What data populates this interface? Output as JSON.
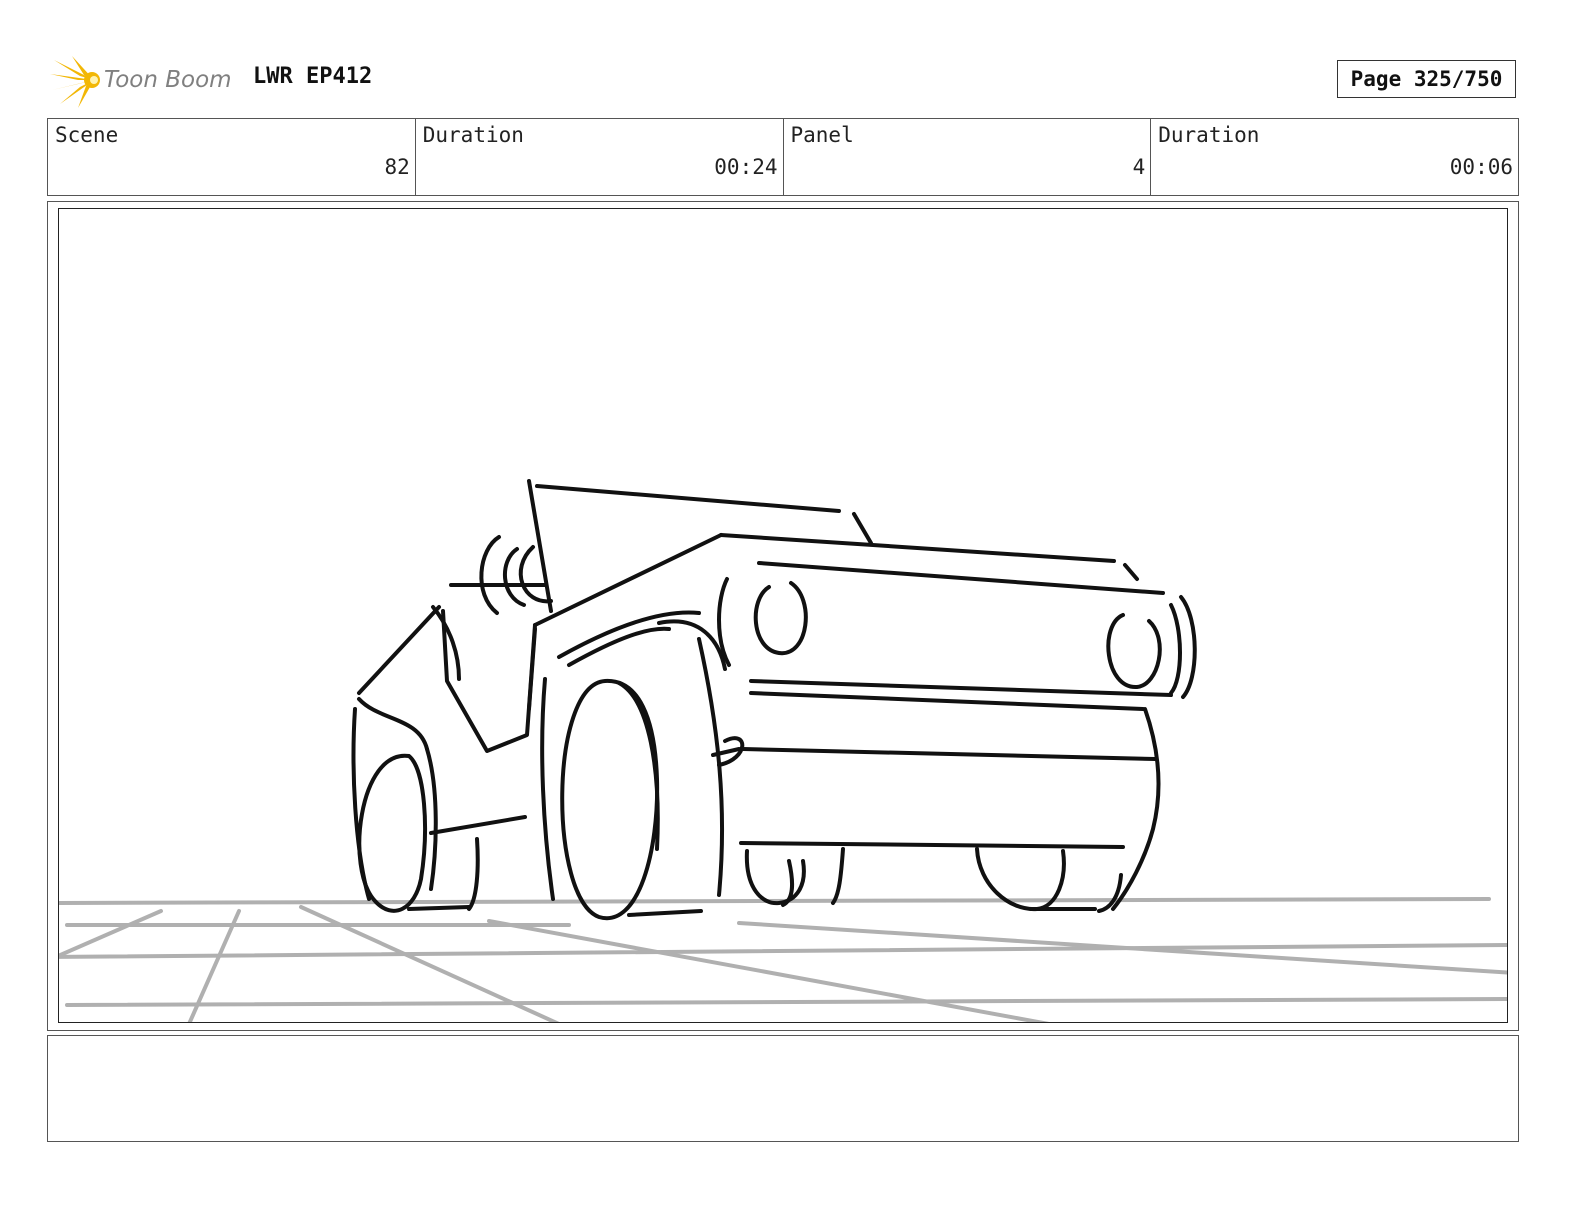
{
  "header": {
    "logo_text": "Toon Boom",
    "project": "LWR EP412",
    "page": "Page 325/750"
  },
  "info": {
    "scene_label": "Scene",
    "scene_value": "82",
    "scene_duration_label": "Duration",
    "scene_duration_value": "00:24",
    "panel_label": "Panel",
    "panel_value": "4",
    "panel_duration_label": "Duration",
    "panel_duration_value": "00:06"
  },
  "notes": {
    "text": ""
  },
  "colors": {
    "sketch_ink": "#111111",
    "ground_grid": "#b0b0b0",
    "logo_yellow": "#f2b705",
    "logo_gray": "#808080"
  }
}
